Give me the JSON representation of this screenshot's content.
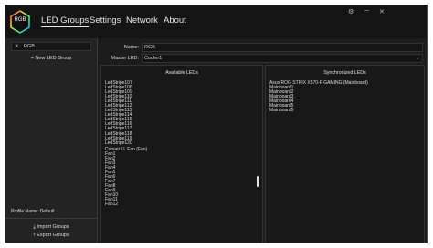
{
  "app": {
    "logo_text": "RGB",
    "nav": [
      {
        "label": "LED Groups",
        "active": true
      },
      {
        "label": "Settings",
        "active": false
      },
      {
        "label": "Network",
        "active": false
      },
      {
        "label": "About",
        "active": false
      }
    ],
    "window_controls": [
      "⚙",
      "─",
      "✕"
    ]
  },
  "sidebar": {
    "selected_group": "RGB",
    "close_glyph": "✕",
    "new_group_label": "+ New LED Group",
    "profile_label": "Profile Name: Default",
    "import_label": "Import Groups",
    "export_label": "Export Groups"
  },
  "form": {
    "name_label": "Name:",
    "name_value": "RGB",
    "master_label": "Master LED:",
    "master_value": "Cooler1"
  },
  "available": {
    "title": "Available LEDs",
    "items": [
      "LedStripe107",
      "LedStripe108",
      "LedStripe109",
      "LedStripe110",
      "LedStripe111",
      "LedStripe112",
      "LedStripe113",
      "LedStripe114",
      "LedStripe115",
      "LedStripe116",
      "LedStripe117",
      "LedStripe118",
      "LedStripe119",
      "LedStripe120"
    ],
    "group2_title": "Corsair LL Fan (Fan)",
    "group2_items": [
      "Fan1",
      "Fan2",
      "Fan3",
      "Fan4",
      "Fan5",
      "Fan6",
      "Fan7",
      "Fan8",
      "Fan9",
      "Fan10",
      "Fan11",
      "Fan12"
    ]
  },
  "synchronized": {
    "title": "Synchronized LEDs",
    "group_title": "Asus ROG STRIX X570-F GAMING (Mainboard)",
    "items": [
      "Mainboard1",
      "Mainboard2",
      "Mainboard3",
      "Mainboard4",
      "Mainboard5",
      "Mainboard5"
    ]
  }
}
